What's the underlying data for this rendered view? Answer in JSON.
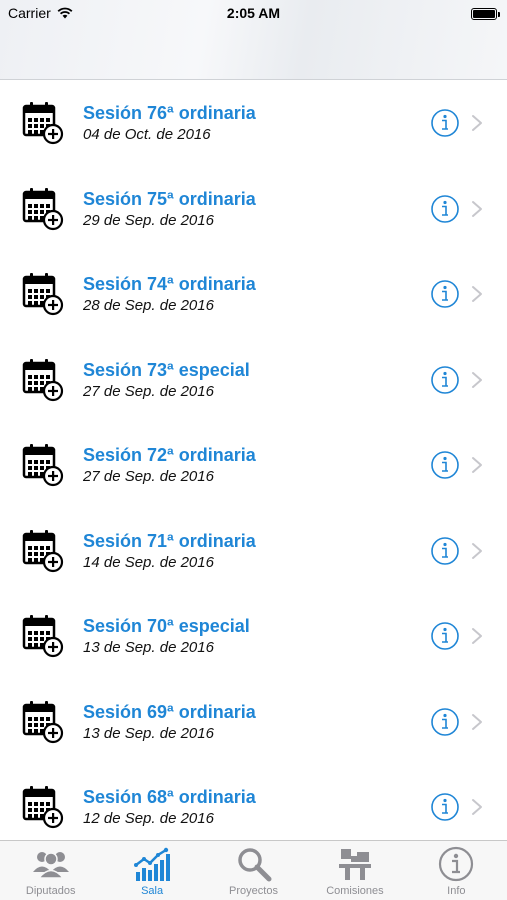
{
  "status_bar": {
    "carrier": "Carrier",
    "time": "2:05 AM"
  },
  "colors": {
    "accent": "#1f86d6",
    "inactive": "#8e8e93"
  },
  "sessions": [
    {
      "title": "Sesión 76ª ordinaria",
      "date": "04 de Oct. de 2016"
    },
    {
      "title": "Sesión 75ª ordinaria",
      "date": "29 de Sep. de 2016"
    },
    {
      "title": "Sesión 74ª ordinaria",
      "date": "28 de Sep. de 2016"
    },
    {
      "title": "Sesión 73ª especial",
      "date": "27 de Sep. de 2016"
    },
    {
      "title": "Sesión 72ª ordinaria",
      "date": "27 de Sep. de 2016"
    },
    {
      "title": "Sesión 71ª ordinaria",
      "date": "14 de Sep. de 2016"
    },
    {
      "title": "Sesión 70ª especial",
      "date": "13 de Sep. de 2016"
    },
    {
      "title": "Sesión 69ª ordinaria",
      "date": "13 de Sep. de 2016"
    },
    {
      "title": "Sesión 68ª ordinaria",
      "date": "12 de Sep. de 2016"
    }
  ],
  "tabs": [
    {
      "label": "Diputados",
      "icon": "people-icon",
      "active": false
    },
    {
      "label": "Sala",
      "icon": "chart-icon",
      "active": true
    },
    {
      "label": "Proyectos",
      "icon": "magnifier-icon",
      "active": false
    },
    {
      "label": "Comisiones",
      "icon": "committee-icon",
      "active": false
    },
    {
      "label": "Info",
      "icon": "info-icon",
      "active": false
    }
  ]
}
